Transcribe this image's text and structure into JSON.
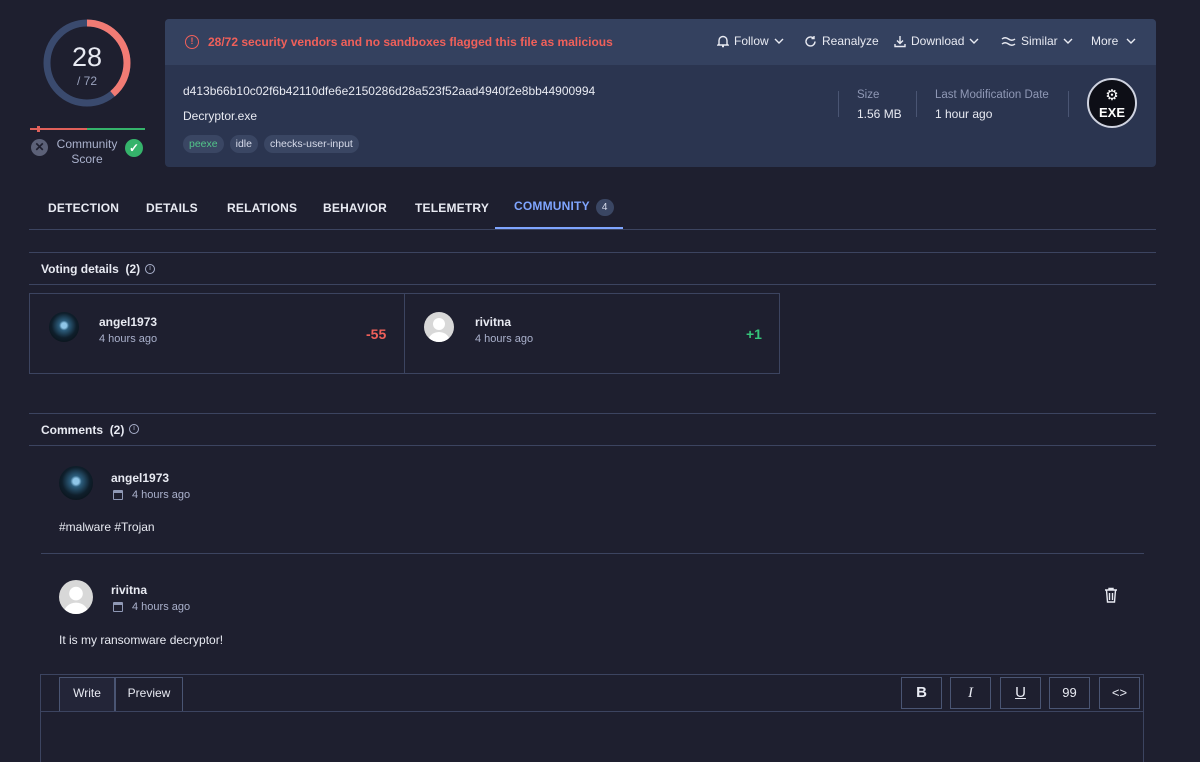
{
  "score": {
    "detected": "28",
    "total": "/ 72",
    "community_label_1": "Community",
    "community_label_2": "Score"
  },
  "alert": "28/72 security vendors and no sandboxes flagged this file as malicious",
  "actions": {
    "follow": "Follow",
    "reanalyze": "Reanalyze",
    "download": "Download",
    "similar": "Similar",
    "more": "More"
  },
  "file": {
    "hash": "d413b66b10c02f6b42110dfe6e2150286d28a523f52aad4940f2e8bb44900994",
    "name": "Decryptor.exe",
    "tags": [
      "peexe",
      "idle",
      "checks-user-input"
    ],
    "size_label": "Size",
    "size_value": "1.56 MB",
    "mod_label": "Last Modification Date",
    "mod_value": "1 hour ago",
    "type_badge": "EXE"
  },
  "tabs": [
    {
      "label": "DETECTION"
    },
    {
      "label": "DETAILS"
    },
    {
      "label": "RELATIONS"
    },
    {
      "label": "BEHAVIOR"
    },
    {
      "label": "TELEMETRY"
    },
    {
      "label": "COMMUNITY",
      "badge": "4"
    }
  ],
  "voting": {
    "title": "Voting details",
    "count": "(2)",
    "votes": [
      {
        "user": "angel1973",
        "time": "4 hours ago",
        "value": "-55"
      },
      {
        "user": "rivitna",
        "time": "4 hours ago",
        "value": "+1"
      }
    ]
  },
  "comments": {
    "title": "Comments",
    "count": "(2)",
    "items": [
      {
        "user": "angel1973",
        "time": "4 hours ago",
        "text": "#malware #Trojan"
      },
      {
        "user": "rivitna",
        "time": "4 hours ago",
        "text": "It is my ransomware decryptor!"
      }
    ]
  },
  "editor": {
    "write_tab": "Write",
    "preview_tab": "Preview",
    "bold": "B",
    "italic": "I",
    "underline": "U",
    "quote": "99",
    "code": "<>"
  },
  "colors": {
    "background": "#1e1f2f",
    "header": "#2b3550",
    "danger": "#f0605a",
    "success": "#35c57a",
    "accent": "#7fa5ff"
  },
  "score_fraction": 0.389
}
